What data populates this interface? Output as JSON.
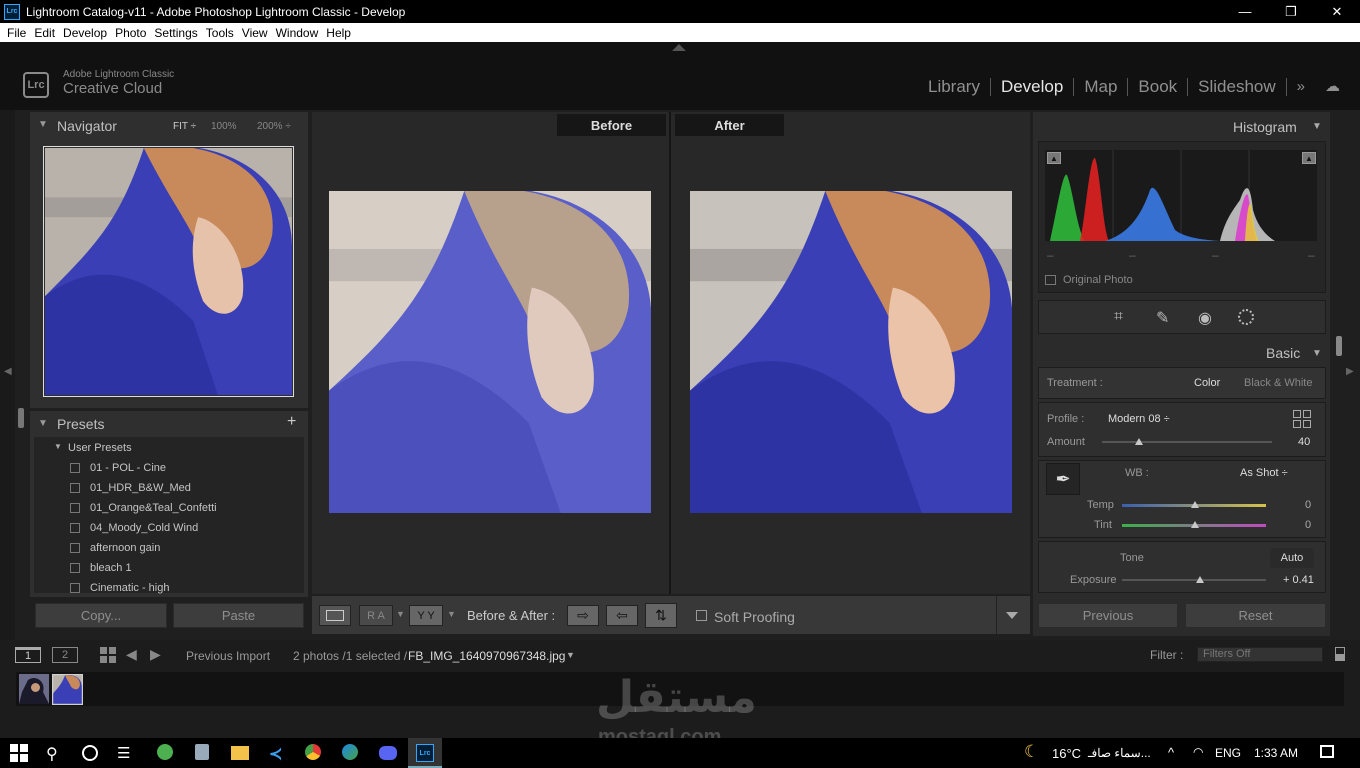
{
  "window": {
    "title": "Lightroom Catalog-v11 - Adobe Photoshop Lightroom Classic - Develop",
    "app_badge": "Lrc"
  },
  "menu": [
    "File",
    "Edit",
    "Develop",
    "Photo",
    "Settings",
    "Tools",
    "View",
    "Window",
    "Help"
  ],
  "identity": {
    "line1": "Adobe Lightroom Classic",
    "line2": "Creative Cloud",
    "logo": "Lrc"
  },
  "modules": [
    "Library",
    "Develop",
    "Map",
    "Book",
    "Slideshow"
  ],
  "navigator": {
    "title": "Navigator",
    "fit": "FIT ÷",
    "zoom1": "100%",
    "zoom2": "200% ÷"
  },
  "presets": {
    "title": "Presets",
    "group": "User Presets",
    "items": [
      "01 - POL - Cine",
      "01_HDR_B&W_Med",
      "01_Orange&Teal_Confetti",
      "04_Moody_Cold Wind",
      "afternoon gain",
      "bleach 1",
      "Cinematic - high"
    ]
  },
  "left_buttons": {
    "copy": "Copy...",
    "paste": "Paste"
  },
  "compare": {
    "before": "Before",
    "after": "After"
  },
  "toolbar": {
    "ra": "R A",
    "yy": "Y Y",
    "label": "Before & After :",
    "soft_proofing": "Soft Proofing"
  },
  "histogram": {
    "title": "Histogram",
    "original_photo": "Original Photo",
    "dash": "–"
  },
  "basic": {
    "title": "Basic",
    "treatment_label": "Treatment :",
    "color": "Color",
    "bw": "Black & White",
    "profile_label": "Profile :",
    "profile_value": "Modern 08 ÷",
    "amount_label": "Amount",
    "amount_value": "40",
    "wb_label": "WB :",
    "wb_value": "As Shot ÷",
    "temp_label": "Temp",
    "temp_value": "0",
    "tint_label": "Tint",
    "tint_value": "0",
    "tone_label": "Tone",
    "auto": "Auto",
    "exposure_label": "Exposure",
    "exposure_value": "+ 0.41"
  },
  "right_buttons": {
    "previous": "Previous",
    "reset": "Reset"
  },
  "filmstrip": {
    "view1": "1",
    "view2": "2",
    "source": "Previous Import",
    "count": "2 photos /1 selected /",
    "file": "FB_IMG_1640970967348.jpg",
    "filter_label": "Filter :",
    "filter_value": "Filters Off"
  },
  "watermark": {
    "arabic": "مستقل",
    "latin": "mostaql.com"
  },
  "taskbar": {
    "temp": "16°C",
    "weather": "سماء صافـ...",
    "lang": "ENG",
    "time": "1:33 AM",
    "moon": "☾"
  },
  "colors": {
    "accent_lrc": "#31a8ff",
    "jacket": "#3a3fb5",
    "hair": "#c88a5a"
  },
  "amount_fraction": 0.22,
  "temp_fraction": 0.51,
  "tint_fraction": 0.51,
  "exposure_fraction": 0.54
}
